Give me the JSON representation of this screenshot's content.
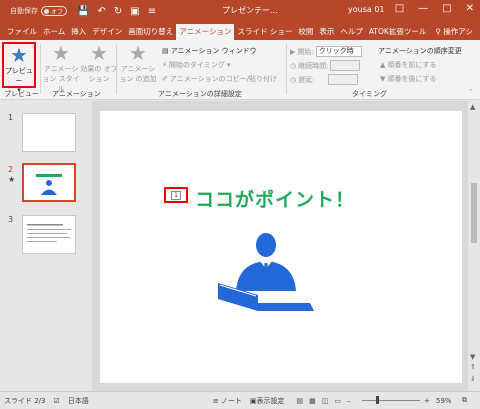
{
  "titlebar": {
    "autosave_label": "自動保存",
    "autosave_state": "オフ",
    "doc_title": "プレゼンテー...",
    "user": "yousa 01",
    "accent": "#b7472a"
  },
  "tabs": {
    "file": "ファイル",
    "home": "ホーム",
    "insert": "挿入",
    "design": "デザイン",
    "transitions": "画面切り替え",
    "animations": "アニメーション",
    "slideshow": "スライド ショー",
    "review": "校閲",
    "view": "表示",
    "help": "ヘルプ",
    "atok": "ATOK拡張ツール",
    "search": "操作アシ"
  },
  "ribbon": {
    "preview": "プレビュー",
    "animation_style": "アニメーション スタイル",
    "effect_options": "効果の オプション",
    "add_animation": "アニメーション の追加",
    "animation_window": "アニメーション ウィンドウ",
    "trigger": "開始のタイミング",
    "animation_painter": "アニメーションのコピー/貼り付け",
    "start_label": "開始:",
    "start_value": "クリック時",
    "duration_label": "継続時間:",
    "delay_label": "遅延:",
    "reorder_title": "アニメーションの順序変更",
    "move_earlier": "順番を前にする",
    "move_later": "順番を後にする",
    "group_preview": "プレビュー",
    "group_animation": "アニメーション",
    "group_advanced": "アニメーションの詳細設定",
    "group_timing": "タイミング"
  },
  "thumbnails": {
    "slide1": "1",
    "slide2": "2",
    "slide3": "3",
    "anim_marker": "★"
  },
  "slide": {
    "title": "ココがポイント！",
    "animation_tag": "1",
    "title_color": "#22a85a",
    "figure_color": "#2468d8"
  },
  "statusbar": {
    "slide_info": "スライド 2/3",
    "language": "日本語",
    "notes": "ノート",
    "display_settings": "表示設定",
    "zoom": "59%",
    "zoom_level": 0.59
  }
}
